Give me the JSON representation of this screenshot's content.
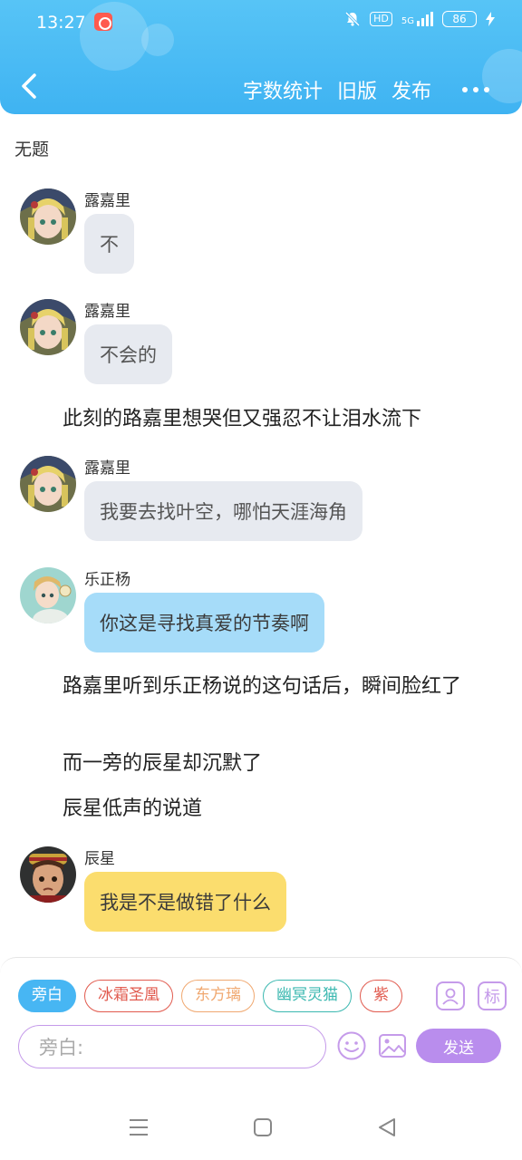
{
  "status_bar": {
    "time": "13:27",
    "signal": "5G",
    "hd": "HD",
    "battery": "86"
  },
  "header": {
    "actions": [
      "字数统计",
      "旧版",
      "发布"
    ]
  },
  "document": {
    "title": "无题"
  },
  "messages": [
    {
      "speaker": "露嘉里",
      "text": "不",
      "style": "grey"
    },
    {
      "speaker": "露嘉里",
      "text": "不会的",
      "style": "grey"
    },
    {
      "narration": "此刻的路嘉里想哭但又强忍不让泪水流下"
    },
    {
      "speaker": "露嘉里",
      "text": "我要去找叶空，哪怕天涯海角",
      "style": "grey"
    },
    {
      "speaker": "乐正杨",
      "text": "你这是寻找真爱的节奏啊",
      "style": "blue"
    },
    {
      "narration": "路嘉里听到乐正杨说的这句话后，瞬间脸红了"
    },
    {
      "narration": "而一旁的辰星却沉默了"
    },
    {
      "narration": "辰星低声的说道"
    },
    {
      "speaker": "辰星",
      "text": "我是不是做错了什么",
      "style": "yellow"
    }
  ],
  "composer": {
    "roles": [
      "旁白",
      "冰霜圣凰",
      "东方璃",
      "幽冥灵猫",
      "紫"
    ],
    "role_colors": [
      "#47b6f3",
      "#e15a4e",
      "#f0a870",
      "#3bb8b0",
      "#e15a4e"
    ],
    "mark_label": "标",
    "input_placeholder": "旁白:",
    "send_label": "发送"
  },
  "colors": {
    "header": "#4cbcf4",
    "accent_purple": "#b98ded"
  }
}
